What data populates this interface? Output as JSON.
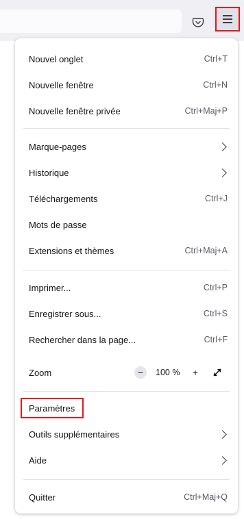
{
  "menu": {
    "group1": [
      {
        "label": "Nouvel onglet",
        "shortcut": "Ctrl+T"
      },
      {
        "label": "Nouvelle fenêtre",
        "shortcut": "Ctrl+N"
      },
      {
        "label": "Nouvelle fenêtre privée",
        "shortcut": "Ctrl+Maj+P"
      }
    ],
    "group2": [
      {
        "label": "Marque-pages",
        "icon": "chevron-right-icon"
      },
      {
        "label": "Historique",
        "icon": "chevron-right-icon"
      },
      {
        "label": "Téléchargements",
        "shortcut": "Ctrl+J"
      },
      {
        "label": "Mots de passe"
      },
      {
        "label": "Extensions et thèmes",
        "shortcut": "Ctrl+Maj+A"
      }
    ],
    "group3": [
      {
        "label": "Imprimer...",
        "shortcut": "Ctrl+P"
      },
      {
        "label": "Enregistrer sous...",
        "shortcut": "Ctrl+S"
      },
      {
        "label": "Rechercher dans la page...",
        "shortcut": "Ctrl+F"
      }
    ],
    "zoom": {
      "label": "Zoom",
      "minus": "−",
      "value": "100 %",
      "plus": "+"
    },
    "group4": [
      {
        "label": "Paramètres"
      },
      {
        "label": "Outils supplémentaires",
        "icon": "chevron-right-icon"
      },
      {
        "label": "Aide",
        "icon": "chevron-right-icon"
      }
    ],
    "group5": [
      {
        "label": "Quitter",
        "shortcut": "Ctrl+Maj+Q"
      }
    ]
  },
  "colors": {
    "highlight": "#e8141c",
    "panel_bg": "#ffffff",
    "toolbar_bg": "#f0f0f4"
  }
}
